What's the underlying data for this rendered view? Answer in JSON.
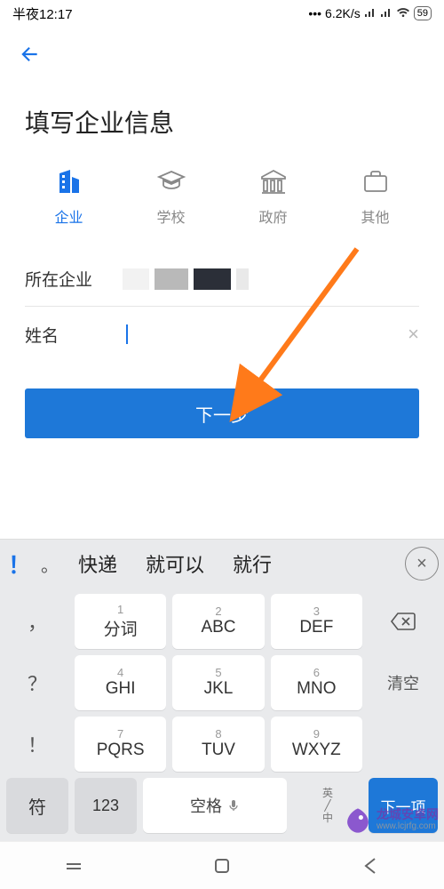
{
  "status": {
    "time": "半夜12:17",
    "net_speed": "6.2K/s",
    "battery": "59"
  },
  "page": {
    "title": "填写企业信息"
  },
  "categories": [
    {
      "id": "enterprise",
      "label": "企业",
      "active": true
    },
    {
      "id": "school",
      "label": "学校",
      "active": false
    },
    {
      "id": "government",
      "label": "政府",
      "active": false
    },
    {
      "id": "other",
      "label": "其他",
      "active": false
    }
  ],
  "fields": {
    "company_label": "所在企业",
    "name_label": "姓名"
  },
  "buttons": {
    "next": "下一步"
  },
  "keyboard": {
    "candidates": [
      "快递",
      "就可以",
      "就行"
    ],
    "punct_big": "！",
    "punct_small": "。",
    "keys": {
      "1": {
        "num": "1",
        "main": "分词"
      },
      "2": {
        "num": "2",
        "main": "ABC"
      },
      "3": {
        "num": "3",
        "main": "DEF"
      },
      "4": {
        "num": "4",
        "main": "GHI"
      },
      "5": {
        "num": "5",
        "main": "JKL"
      },
      "6": {
        "num": "6",
        "main": "MNO"
      },
      "7": {
        "num": "7",
        "main": "PQRS"
      },
      "8": {
        "num": "8",
        "main": "TUV"
      },
      "9": {
        "num": "9",
        "main": "WXYZ"
      }
    },
    "side": {
      "comma": "，",
      "question": "？",
      "exclaim": "！",
      "clear": "清空"
    },
    "bottom": {
      "symbol": "符",
      "number": "123",
      "space": "空格",
      "lang_a": "英",
      "lang_b": "中",
      "action": "下一项"
    }
  },
  "watermark": {
    "name": "龙城安卓网",
    "url": "www.lcjrfg.com"
  }
}
